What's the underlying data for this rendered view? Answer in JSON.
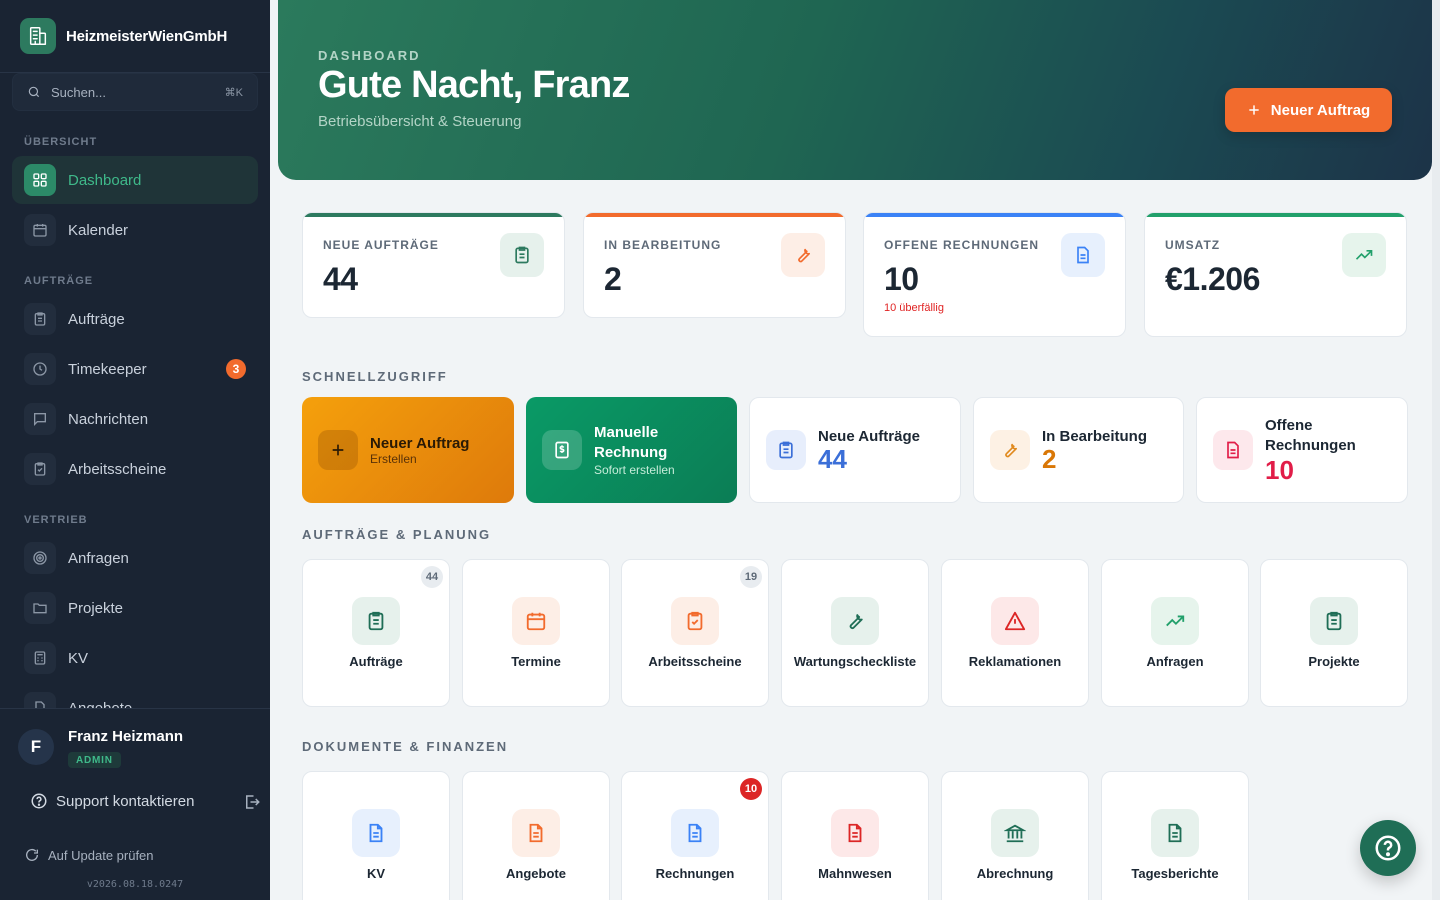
{
  "sidebar": {
    "brand": "HeizmeisterWienGmbH",
    "search": {
      "placeholder": "Suchen...",
      "shortcut": "⌘K"
    },
    "sections": {
      "overview": "ÜBERSICHT",
      "orders": "AUFTRÄGE",
      "sales": "VERTRIEB"
    },
    "items": {
      "dashboard": "Dashboard",
      "kalender": "Kalender",
      "auftraege": "Aufträge",
      "timekeeper": "Timekeeper",
      "timekeeper_badge": "3",
      "nachrichten": "Nachrichten",
      "arbeitsscheine": "Arbeitsscheine",
      "anfragen": "Anfragen",
      "projekte": "Projekte",
      "kv": "KV",
      "angebote": "Angebote"
    },
    "user": {
      "initial": "F",
      "name": "Franz Heizmann",
      "role": "ADMIN"
    },
    "support": "Support kontaktieren",
    "update": "Auf Update prüfen",
    "version": "v2026.08.18.0247"
  },
  "hero": {
    "eyebrow": "DASHBOARD",
    "title": "Gute Nacht, Franz",
    "subtitle": "Betriebsübersicht & Steuerung",
    "button": "Neuer Auftrag"
  },
  "stats": [
    {
      "label": "NEUE AUFTRÄGE",
      "value": "44",
      "color": "#2d7a5f"
    },
    {
      "label": "IN BEARBEITUNG",
      "value": "2",
      "color": "#f26b2d"
    },
    {
      "label": "OFFENE RECHNUNGEN",
      "value": "10",
      "note": "10 überfällig",
      "color": "#3b82f6"
    },
    {
      "label": "UMSATZ",
      "value": "€1.206",
      "color": "#22a06b"
    }
  ],
  "sections": {
    "quick": "SCHNELLZUGRIFF",
    "planning": "AUFTRÄGE & PLANUNG",
    "docs": "DOKUMENTE & FINANZEN"
  },
  "quick": {
    "new_order": {
      "title": "Neuer Auftrag",
      "sub": "Erstellen"
    },
    "manual_invoice": {
      "title": "Manuelle Rechnung",
      "sub": "Sofort erstellen"
    },
    "new_orders": {
      "title": "Neue Aufträge",
      "value": "44"
    },
    "in_progress": {
      "title": "In Bearbeitung",
      "value": "2"
    },
    "open_invoices": {
      "title": "Offene Rechnungen",
      "value": "10"
    }
  },
  "planning_tiles": [
    {
      "label": "Aufträge",
      "count": "44",
      "icon": "clipboard-icon"
    },
    {
      "label": "Termine",
      "icon": "calendar-icon"
    },
    {
      "label": "Arbeitsscheine",
      "count": "19",
      "icon": "clipboard-check-icon"
    },
    {
      "label": "Wartungscheckliste",
      "icon": "wrench-icon"
    },
    {
      "label": "Reklamationen",
      "icon": "warning-icon"
    },
    {
      "label": "Anfragen",
      "icon": "trend-up-icon"
    },
    {
      "label": "Projekte",
      "icon": "clipboard-list-icon"
    }
  ],
  "doc_tiles": [
    {
      "label": "KV",
      "icon": "document-icon"
    },
    {
      "label": "Angebote",
      "icon": "document-icon"
    },
    {
      "label": "Rechnungen",
      "alert": "10",
      "icon": "document-icon"
    },
    {
      "label": "Mahnwesen",
      "icon": "document-icon"
    },
    {
      "label": "Abrechnung",
      "icon": "bank-icon"
    },
    {
      "label": "Tagesberichte",
      "icon": "document-icon"
    }
  ]
}
